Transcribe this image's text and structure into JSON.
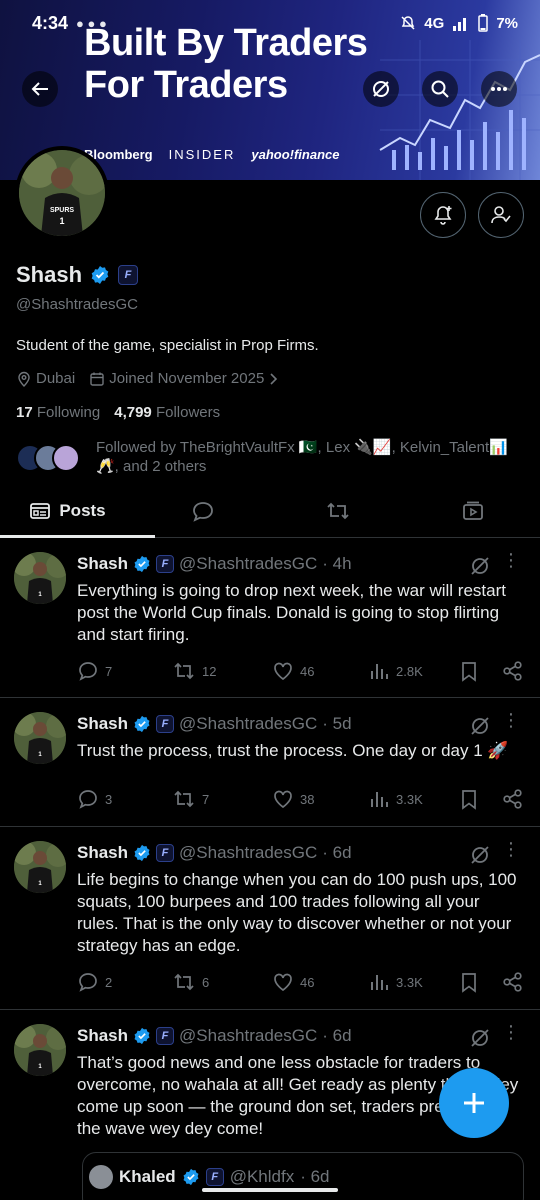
{
  "status_bar": {
    "time": "4:34",
    "network": "4G",
    "battery": "7%"
  },
  "banner": {
    "headline_line1": "Built By Traders",
    "headline_line2": "For Traders",
    "brands": [
      "Bloomberg",
      "INSIDER",
      "yahoo!finance"
    ]
  },
  "profile": {
    "name": "Shash",
    "handle": "@ShashtradesGC",
    "bio": "Student of the game, specialist in Prop Firms.",
    "location": "Dubai",
    "joined": "Joined November 2025",
    "following_count": "17",
    "following_label": "Following",
    "followers_count": "4,799",
    "followers_label": "Followers",
    "followed_by": "Followed by TheBrightVaultFx 🇵🇰, Lex 🔌📈, Kelvin_Talent📊🥂, and 2 others"
  },
  "tabs": [
    {
      "label": "Posts",
      "icon": "posts-icon",
      "active": true
    },
    {
      "label": "",
      "icon": "replies-icon",
      "active": false
    },
    {
      "label": "",
      "icon": "reposts-icon",
      "active": false
    },
    {
      "label": "",
      "icon": "media-icon",
      "active": false
    }
  ],
  "tweets": [
    {
      "name": "Shash",
      "handle": "@ShashtradesGC",
      "time": "· 4h",
      "text": "Everything is going to drop next week, the war will restart post the World Cup finals. Donald is going to stop flirting and start firing.",
      "replies": "7",
      "reposts": "12",
      "likes": "46",
      "views": "2.8K"
    },
    {
      "name": "Shash",
      "handle": "@ShashtradesGC",
      "time": "· 5d",
      "text": "Trust the process, trust the process. One day or day 1 🚀",
      "replies": "3",
      "reposts": "7",
      "likes": "38",
      "views": "3.3K"
    },
    {
      "name": "Shash",
      "handle": "@ShashtradesGC",
      "time": "· 6d",
      "text": "Life begins to change when you can do 100 push ups, 100 squats, 100 burpees and 100 trades following all your rules. That is the only way to discover whether or not your strategy has an edge.",
      "replies": "2",
      "reposts": "6",
      "likes": "46",
      "views": "3.3K"
    },
    {
      "name": "Shash",
      "handle": "@ShashtradesGC",
      "time": "· 6d",
      "text": "That’s good news and one less obstacle for traders to overcome, no wahala at all! Get ready as plenty things dey come up soon — the ground don set, traders prepare for the wave wey dey come!"
    }
  ],
  "quote": {
    "name": "Khaled",
    "handle": "@Khldfx",
    "time": "· 6d"
  },
  "colors": {
    "accent": "#1d9bf0",
    "muted": "#71767b",
    "divider": "#2f3336",
    "text": "#e7e9ea",
    "background": "#000000"
  }
}
